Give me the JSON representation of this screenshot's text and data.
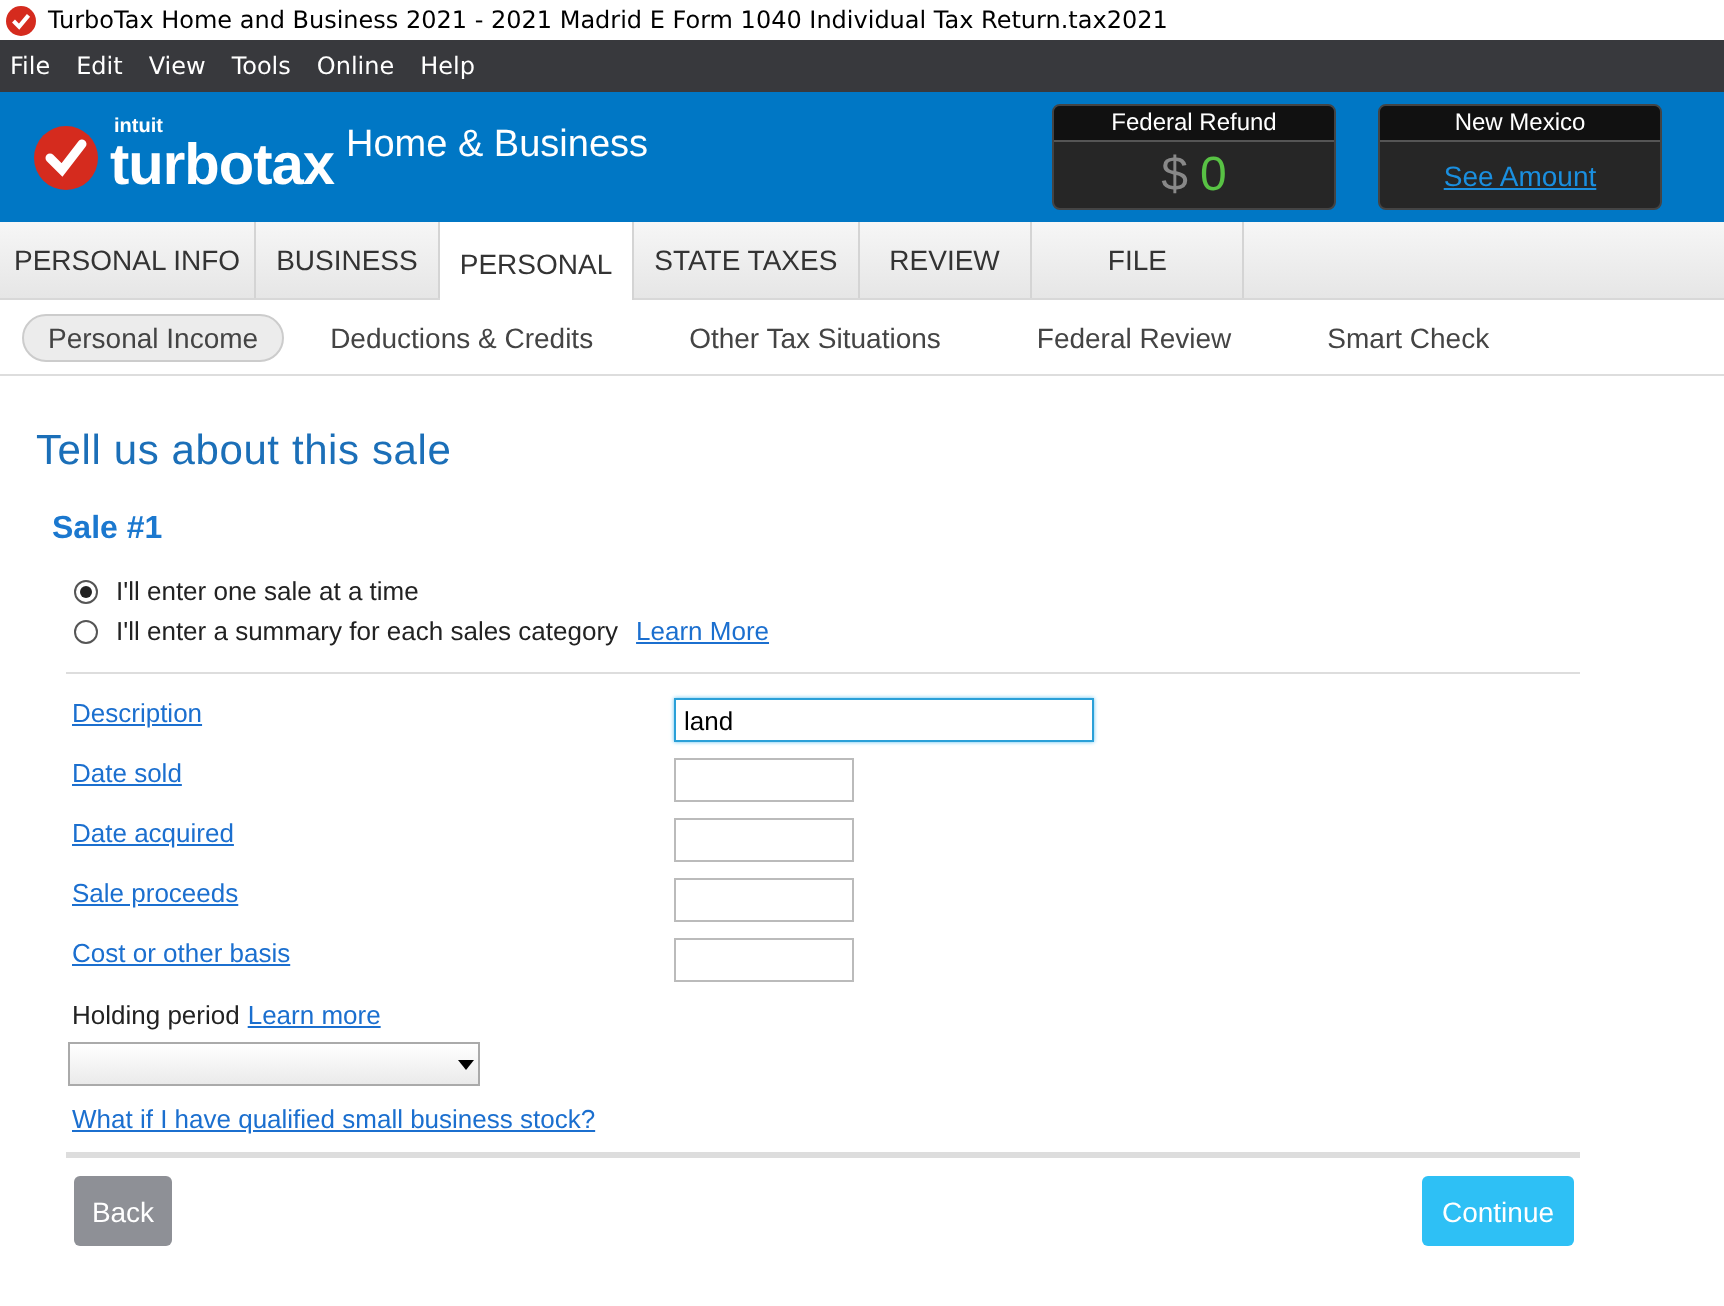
{
  "window": {
    "title": "TurboTax Home and Business 2021 - 2021 Madrid E Form 1040  Individual Tax Return.tax2021"
  },
  "menu": [
    "File",
    "Edit",
    "View",
    "Tools",
    "Online",
    "Help"
  ],
  "header": {
    "brand_small": "intuit",
    "brand": "turbotax",
    "edition": "Home & Business",
    "refunds": [
      {
        "label": "Federal Refund",
        "kind": "amount",
        "currency": "$",
        "amount": "0"
      },
      {
        "label": "New Mexico",
        "kind": "link",
        "link": "See Amount"
      }
    ]
  },
  "tabs": [
    {
      "label": "PERSONAL INFO",
      "selected": false
    },
    {
      "label": "BUSINESS",
      "selected": false
    },
    {
      "label": "PERSONAL",
      "selected": true
    },
    {
      "label": "STATE TAXES",
      "selected": false
    },
    {
      "label": "REVIEW",
      "selected": false
    },
    {
      "label": "FILE",
      "selected": false
    }
  ],
  "subnav": [
    {
      "label": "Personal Income",
      "selected": true
    },
    {
      "label": "Deductions & Credits",
      "selected": false
    },
    {
      "label": "Other Tax Situations",
      "selected": false
    },
    {
      "label": "Federal Review",
      "selected": false
    },
    {
      "label": "Smart Check",
      "selected": false
    }
  ],
  "page": {
    "title": "Tell us about this sale",
    "subtitle": "Sale #1",
    "options": [
      {
        "label": "I'll enter one sale at a time",
        "selected": true
      },
      {
        "label": "I'll enter a summary for each sales category",
        "selected": false,
        "link": "Learn More"
      }
    ],
    "fields": [
      {
        "label": "Description",
        "value": "land",
        "focused": true,
        "wide": true
      },
      {
        "label": "Date sold",
        "focused": false,
        "wide": false
      },
      {
        "label": "Date acquired",
        "focused": false,
        "wide": false
      },
      {
        "label": "Sale proceeds",
        "focused": false,
        "wide": false
      },
      {
        "label": "Cost or other basis",
        "focused": false,
        "wide": false
      }
    ],
    "holding": {
      "label": "Holding period",
      "link": "Learn more"
    },
    "stock_link": "What if I have qualified small business stock?",
    "back": "Back",
    "continue": "Continue"
  }
}
